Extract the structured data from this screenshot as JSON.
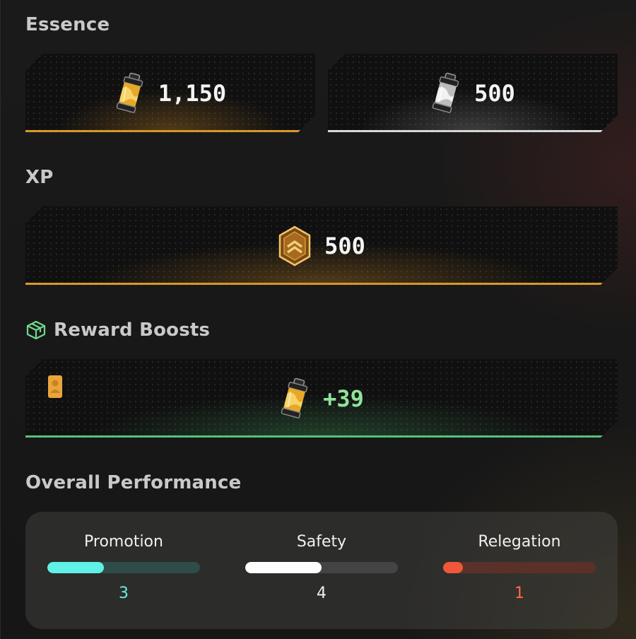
{
  "essence": {
    "title": "Essence",
    "items": [
      {
        "icon": "gold-essence-canister-icon",
        "value": "1,150"
      },
      {
        "icon": "silver-essence-canister-icon",
        "value": "500"
      }
    ]
  },
  "xp": {
    "title": "XP",
    "icon": "xp-rank-badge-icon",
    "value": "500"
  },
  "reward_boosts": {
    "title": "Reward Boosts",
    "title_icon": "gift-box-icon",
    "corner_icon": "player-card-icon",
    "item_icon": "gold-essence-canister-icon",
    "value": "+39"
  },
  "performance": {
    "title": "Overall Performance",
    "columns": [
      {
        "label": "Promotion",
        "count": "3",
        "fill_percent": 37,
        "color": "#5ff0e6",
        "track": "#2f4b4a",
        "count_color": "#6fe6e6"
      },
      {
        "label": "Safety",
        "count": "4",
        "fill_percent": 50,
        "color": "#ffffff",
        "track": "#444444",
        "count_color": "#f0f0f0"
      },
      {
        "label": "Relegation",
        "count": "1",
        "fill_percent": 13,
        "color": "#f0573a",
        "track": "#5a3128",
        "count_color": "#ff6a48"
      }
    ]
  },
  "colors": {
    "gold_accent": "#d59a2b",
    "silver_accent": "#d8d8d8",
    "green_accent": "#55c27c"
  }
}
